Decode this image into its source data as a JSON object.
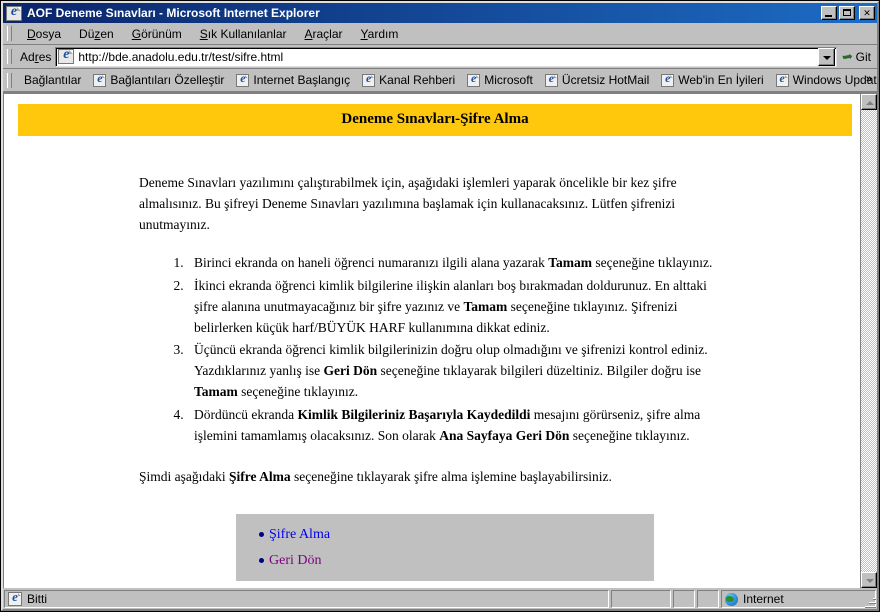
{
  "window": {
    "title": "AOF Deneme Sınavları - Microsoft Internet Explorer",
    "app_icon": "ie-document-icon",
    "minimize_label": "",
    "maximize_label": "",
    "close_label": "✕"
  },
  "menu": {
    "items": [
      {
        "label": "Dosya",
        "accel": "D"
      },
      {
        "label": "Düzen",
        "accel": "z"
      },
      {
        "label": "Görünüm",
        "accel": "G"
      },
      {
        "label": "Sık Kullanılanlar",
        "accel": "S"
      },
      {
        "label": "Araçlar",
        "accel": "A"
      },
      {
        "label": "Yardım",
        "accel": "Y"
      }
    ]
  },
  "address_bar": {
    "label": "Adres",
    "url": "http://bde.anadolu.edu.tr/test/sifre.html",
    "placeholder": "",
    "dropdown_icon": "chevron-down-icon",
    "go_label": "Git",
    "go_icon": "go-arrow-icon"
  },
  "links_bar": {
    "label": "Bağlantılar",
    "items": [
      {
        "label": "Bağlantıları Özelleştir",
        "icon": "ie-page-icon"
      },
      {
        "label": "Internet Başlangıç",
        "icon": "ie-page-icon"
      },
      {
        "label": "Kanal Rehberi",
        "icon": "ie-page-icon"
      },
      {
        "label": "Microsoft",
        "icon": "ie-page-icon"
      },
      {
        "label": "Ücretsiz HotMail",
        "icon": "ie-page-icon"
      },
      {
        "label": "Web'in En İyileri",
        "icon": "ie-page-icon"
      },
      {
        "label": "Windows Update",
        "icon": "ie-page-icon"
      }
    ],
    "overflow_label": "»"
  },
  "page": {
    "banner": {
      "title": "Deneme Sınavları-Şifre Alma",
      "background_color": "#FFC80C",
      "text_color": "#000000"
    },
    "intro": "Deneme Sınavları yazılımını çalıştırabilmek için, aşağıdaki işlemleri yaparak öncelikle bir kez şifre almalısınız. Bu şifreyi Deneme Sınavları yazılımına başlamak için kullanacaksınız. Lütfen şifrenizi unutmayınız.",
    "steps": [
      "Birinci ekranda on haneli öğrenci numaranızı ilgili alana yazarak <b>Tamam</b> seçeneğine tıklayınız.",
      "İkinci ekranda öğrenci kimlik bilgilerine ilişkin alanları boş bırakmadan doldurunuz. En alttaki şifre alanına unutmayacağınız bir şifre yazınız ve <b>Tamam</b> seçeneğine tıklayınız. Şifrenizi belirlerken küçük harf/BÜYÜK HARF kullanımına dikkat ediniz.",
      "Üçüncü ekranda öğrenci kimlik bilgilerinizin doğru olup olmadığını ve şifrenizi kontrol ediniz. Yazdıklarınız yanlış ise <b>Geri Dön</b> seçeneğine tıklayarak bilgileri düzeltiniz. Bilgiler doğru ise <b>Tamam</b> seçeneğine tıklayınız.",
      "Dördüncü ekranda <b>Kimlik Bilgileriniz Başarıyla Kaydedildi</b> mesajını görürseniz, şifre alma işlemini tamamlamış olacaksınız. Son olarak <b>Ana Sayfaya Geri Dön</b> seçeneğine tıklayınız."
    ],
    "closing": "Şimdi aşağıdaki <b>Şifre Alma</b> seçeneğine tıklayarak şifre alma işlemine başlayabilirsiniz.",
    "link_box": {
      "background_color": "#C0C0C0",
      "links": [
        {
          "label": "Şifre Alma",
          "state": "unvisited",
          "color": "#0000EE"
        },
        {
          "label": "Geri Dön",
          "state": "visited",
          "color": "#800080"
        }
      ]
    }
  },
  "status_bar": {
    "status_text": "Bitti",
    "status_icon": "ie-page-icon",
    "zone_text": "Internet",
    "zone_icon": "globe-icon"
  },
  "scrollbar": {
    "up_icon": "triangle-up-icon",
    "down_icon": "triangle-down-icon",
    "state": "disabled"
  }
}
